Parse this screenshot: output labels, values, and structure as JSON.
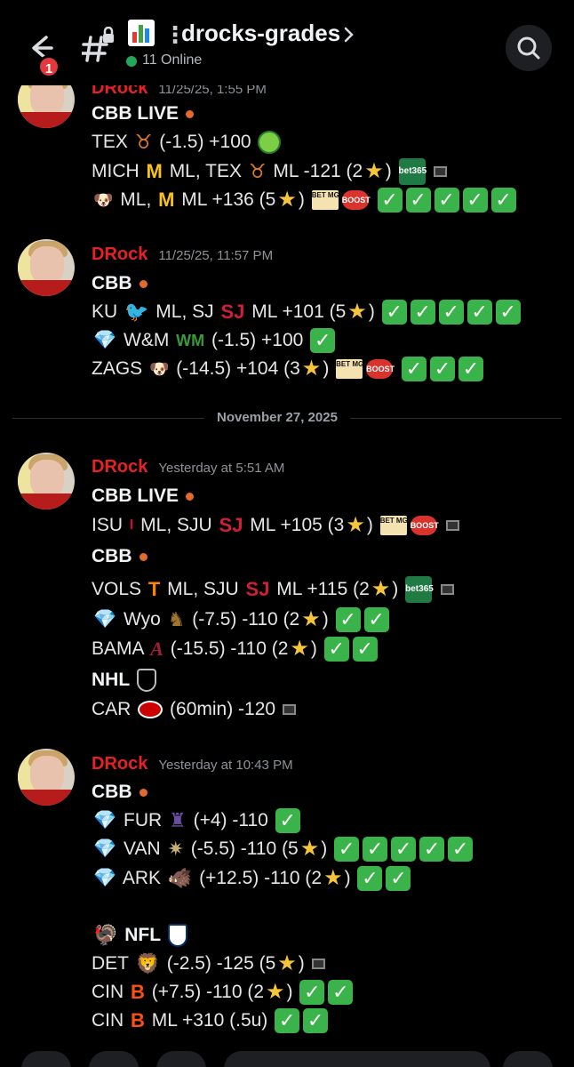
{
  "header": {
    "notification_count": "1",
    "channel_name": "drocks-grades",
    "online_text": "11 Online"
  },
  "messages": [
    {
      "author": "DRock",
      "timestamp": "11/25/25, 1:55 PM",
      "lines": {
        "l1": "CBB LIVE",
        "l2a": "TEX",
        "l2b": "(-1.5) +100",
        "l3a": "MICH",
        "l3b": "ML, TEX",
        "l3c": "ML -121 (2",
        "l3d": ")",
        "l4a": "ML,",
        "l4b": "ML +136 (5",
        "l4c": ")"
      }
    },
    {
      "author": "DRock",
      "timestamp": "11/25/25, 11:57 PM",
      "lines": {
        "l1": "CBB",
        "l2a": "KU",
        "l2b": "ML, SJ",
        "l2c": "ML +101 (5",
        "l2d": ")",
        "l3a": "W&M",
        "l3b": "(-1.5) +100",
        "l4a": "ZAGS",
        "l4b": "(-14.5) +104 (3",
        "l4c": ")"
      }
    },
    {
      "author": "DRock",
      "timestamp": "Yesterday at 5:51 AM",
      "lines": {
        "l1": "CBB LIVE",
        "l2a": "ISU",
        "l2b": "ML, SJU",
        "l2c": "ML +105 (3",
        "l2d": ")",
        "l3": "CBB",
        "l4a": "VOLS",
        "l4b": "ML, SJU",
        "l4c": "ML +115 (2",
        "l4d": ")",
        "l5a": "Wyo",
        "l5b": "(-7.5) -110 (2",
        "l5c": ")",
        "l6a": "BAMA",
        "l6b": "(-15.5) -110 (2",
        "l6c": ")",
        "l7": "NHL",
        "l8a": "CAR",
        "l8b": "(60min) -120"
      }
    },
    {
      "author": "DRock",
      "timestamp": "Yesterday at 10:43 PM",
      "lines": {
        "l1": "CBB",
        "l2a": "FUR",
        "l2b": "(+4) -110",
        "l3a": "VAN",
        "l3b": "(-5.5) -110 (5",
        "l3c": ")",
        "l4a": "ARK",
        "l4b": "(+12.5) -110 (2",
        "l4c": ")",
        "l5": "NFL",
        "l6a": "DET",
        "l6b": "(-2.5) -125 (5",
        "l6c": ")",
        "l7a": "CIN",
        "l7b": "(+7.5) -110 (2",
        "l7c": ")",
        "l8a": "CIN",
        "l8b": "ML +310 (.5u)"
      }
    }
  ],
  "date_divider": "November 27, 2025",
  "icons": {
    "check": "✓",
    "star": "★",
    "gem": "💎",
    "bet365": "bet365",
    "betmgm": "BET MGM",
    "boost": "BOOST"
  },
  "colors": {
    "author": "#e8202a",
    "check_green": "#3ab44a",
    "online_green": "#23a55a",
    "badge_red": "#e5383e"
  }
}
